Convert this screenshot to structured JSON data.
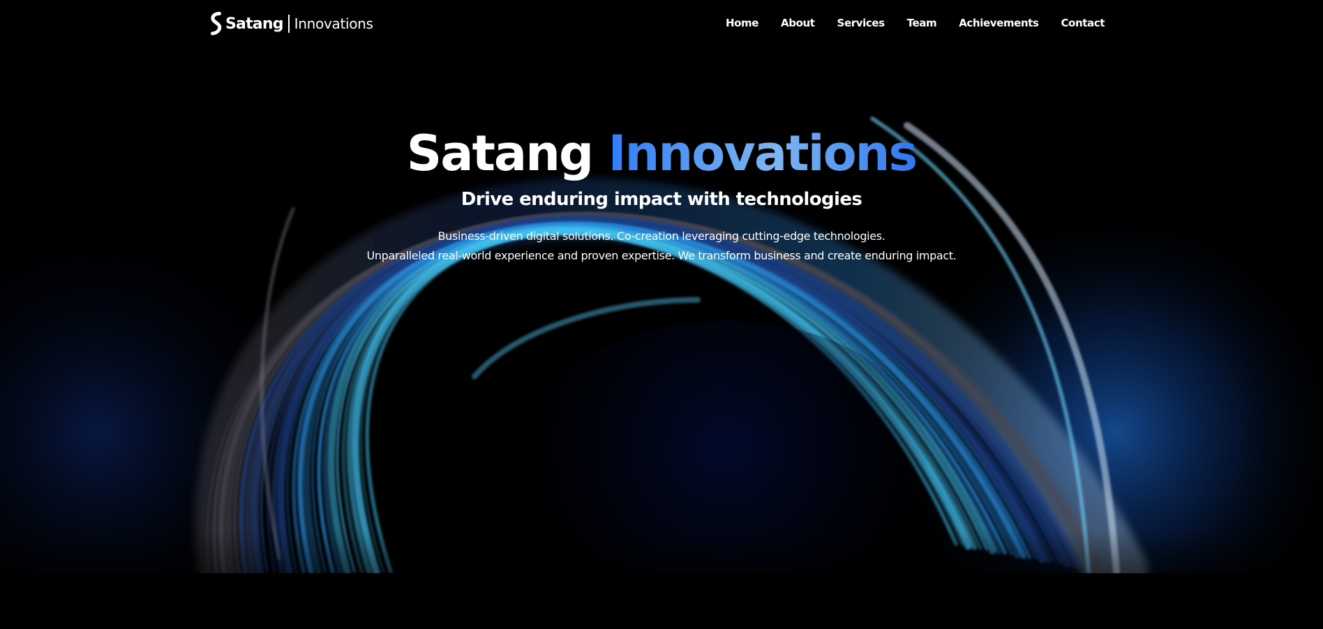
{
  "brand": {
    "name": "Satang",
    "suffix": "Innovations"
  },
  "nav": {
    "items": [
      {
        "label": "Home"
      },
      {
        "label": "About"
      },
      {
        "label": "Services"
      },
      {
        "label": "Team"
      },
      {
        "label": "Achievements"
      },
      {
        "label": "Contact"
      }
    ]
  },
  "hero": {
    "title_main": "Satang",
    "title_accent": "Innovations",
    "subtitle": "Drive enduring impact with technologies",
    "description": [
      "Business-driven digital solutions. Co-creation leveraging cutting-edge technologies.",
      "Unparalleled real-world experience and proven expertise. We transform business and create enduring impact."
    ],
    "background": "abstract-blue-swirl-image"
  },
  "colors": {
    "background": "#000000",
    "accent": "#3b82f6",
    "text": "#ffffff"
  }
}
